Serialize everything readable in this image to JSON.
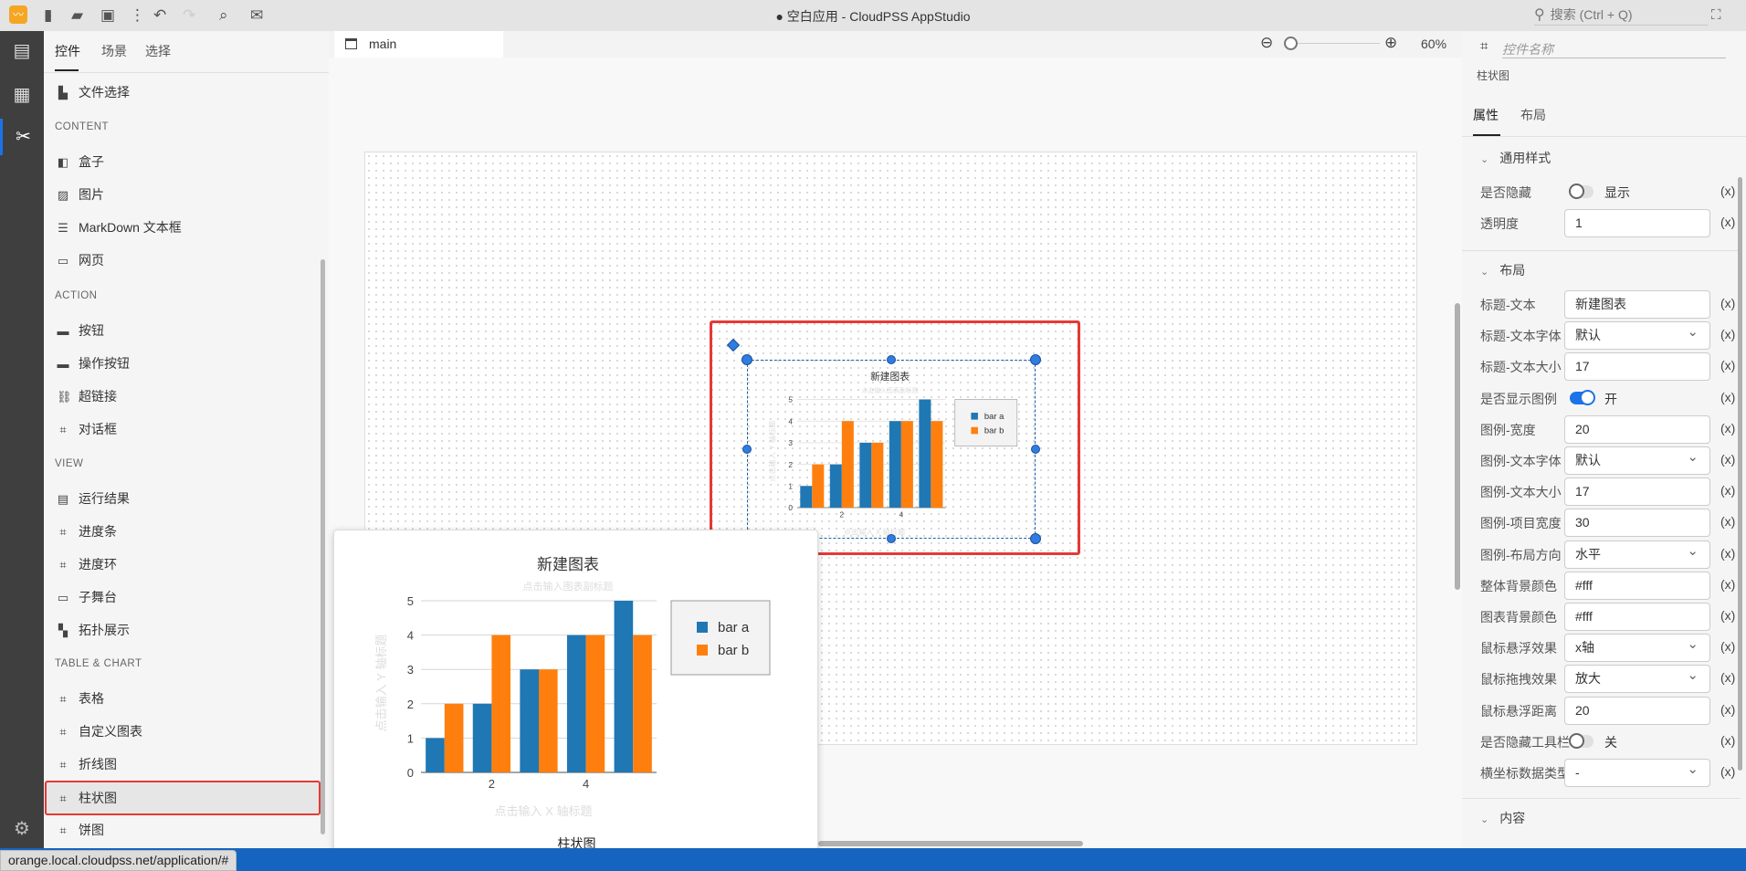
{
  "titlebar": {
    "title": "● 空白应用 - CloudPSS AppStudio",
    "search_placeholder": "搜索 (Ctrl + Q)",
    "icons": [
      "app-logo-icon",
      "new-file-icon",
      "open-folder-icon",
      "save-icon",
      "more-icon",
      "undo-icon",
      "redo-icon",
      "preview-icon",
      "publish-icon"
    ]
  },
  "rail": {
    "icons": [
      "layout-icon",
      "media-icon",
      "tools-icon",
      "gear-icon"
    ],
    "active": "tools-icon"
  },
  "widget_panel": {
    "tabs": [
      "控件",
      "场景",
      "选择"
    ],
    "active_tab": "控件",
    "top_item": {
      "label": "文件选择",
      "icon": "file-icon"
    },
    "sections": [
      {
        "title": "CONTENT",
        "items": [
          {
            "label": "盒子",
            "icon": "box-icon"
          },
          {
            "label": "图片",
            "icon": "image-icon"
          },
          {
            "label": "MarkDown 文本框",
            "icon": "markdown-icon"
          },
          {
            "label": "网页",
            "icon": "webpage-icon"
          }
        ]
      },
      {
        "title": "ACTION",
        "items": [
          {
            "label": "按钮",
            "icon": "button-icon"
          },
          {
            "label": "操作按钮",
            "icon": "button-icon"
          },
          {
            "label": "超链接",
            "icon": "link-icon"
          },
          {
            "label": "对话框",
            "icon": "widget-icon"
          }
        ]
      },
      {
        "title": "VIEW",
        "items": [
          {
            "label": "运行结果",
            "icon": "result-icon"
          },
          {
            "label": "进度条",
            "icon": "widget-icon"
          },
          {
            "label": "进度环",
            "icon": "widget-icon"
          },
          {
            "label": "子舞台",
            "icon": "stage-icon"
          },
          {
            "label": "拓扑展示",
            "icon": "topology-icon"
          }
        ]
      },
      {
        "title": "TABLE & CHART",
        "items": [
          {
            "label": "表格",
            "icon": "widget-icon"
          },
          {
            "label": "自定义图表",
            "icon": "widget-icon"
          },
          {
            "label": "折线图",
            "icon": "widget-icon"
          },
          {
            "label": "柱状图",
            "icon": "widget-icon",
            "selected": true
          },
          {
            "label": "饼图",
            "icon": "widget-icon"
          }
        ]
      }
    ]
  },
  "canvas": {
    "tab": "main",
    "zoom": "60%",
    "zoom_fraction": 0.0
  },
  "popover": {
    "caption": "柱状图"
  },
  "chart_data": {
    "type": "bar",
    "title": "新建图表",
    "subtitle": "点击输入图表副标题",
    "xlabel": "点击输入 X 轴标题",
    "ylabel": "点击输入 Y 轴标题",
    "x": [
      1,
      2,
      3,
      4,
      5
    ],
    "xticks": [
      2,
      4
    ],
    "yticks": [
      0,
      1,
      2,
      3,
      4,
      5
    ],
    "ylim": [
      0,
      5
    ],
    "grid": true,
    "legend": "right",
    "series": [
      {
        "name": "bar a",
        "values": [
          1,
          2,
          3,
          4,
          5
        ],
        "color": "#1f77b4"
      },
      {
        "name": "bar b",
        "values": [
          2,
          4,
          3,
          4,
          4
        ],
        "color": "#ff7f0e"
      }
    ]
  },
  "props_panel": {
    "name_placeholder": "控件名称",
    "type": "柱状图",
    "tabs": [
      "属性",
      "布局"
    ],
    "active_tab": "属性",
    "sections": [
      "通用样式",
      "布局",
      "内容"
    ],
    "general": [
      {
        "label": "是否隐藏",
        "kind": "toggle",
        "on": false,
        "text": "显示"
      },
      {
        "label": "透明度",
        "kind": "input",
        "value": "1"
      }
    ],
    "layout": [
      {
        "label": "标题-文本",
        "kind": "input",
        "value": "新建图表"
      },
      {
        "label": "标题-文本字体",
        "kind": "select",
        "value": "默认"
      },
      {
        "label": "标题-文本大小",
        "kind": "input",
        "value": "17"
      },
      {
        "label": "是否显示图例",
        "kind": "toggle",
        "on": true,
        "text": "开"
      },
      {
        "label": "图例-宽度",
        "kind": "input",
        "value": "20"
      },
      {
        "label": "图例-文本字体",
        "kind": "select",
        "value": "默认"
      },
      {
        "label": "图例-文本大小",
        "kind": "input",
        "value": "17"
      },
      {
        "label": "图例-项目宽度",
        "kind": "input",
        "value": "30"
      },
      {
        "label": "图例-布局方向",
        "kind": "select",
        "value": "水平"
      },
      {
        "label": "整体背景颜色",
        "kind": "input",
        "value": "#fff"
      },
      {
        "label": "图表背景颜色",
        "kind": "input",
        "value": "#fff"
      },
      {
        "label": "鼠标悬浮效果",
        "kind": "select",
        "value": "x轴"
      },
      {
        "label": "鼠标拖拽效果",
        "kind": "select",
        "value": "放大"
      },
      {
        "label": "鼠标悬浮距离",
        "kind": "input",
        "value": "20"
      },
      {
        "label": "是否隐藏工具栏",
        "kind": "toggle",
        "on": false,
        "text": "关"
      },
      {
        "label": "横坐标数据类型",
        "kind": "select",
        "value": "-"
      }
    ],
    "expr_label": "(x)"
  },
  "status": {
    "url": "orange.local.cloudpss.net/application/#"
  },
  "colors": {
    "accent": "#1a73e8",
    "selection": "#e53935",
    "statusbar": "#1565c0"
  }
}
